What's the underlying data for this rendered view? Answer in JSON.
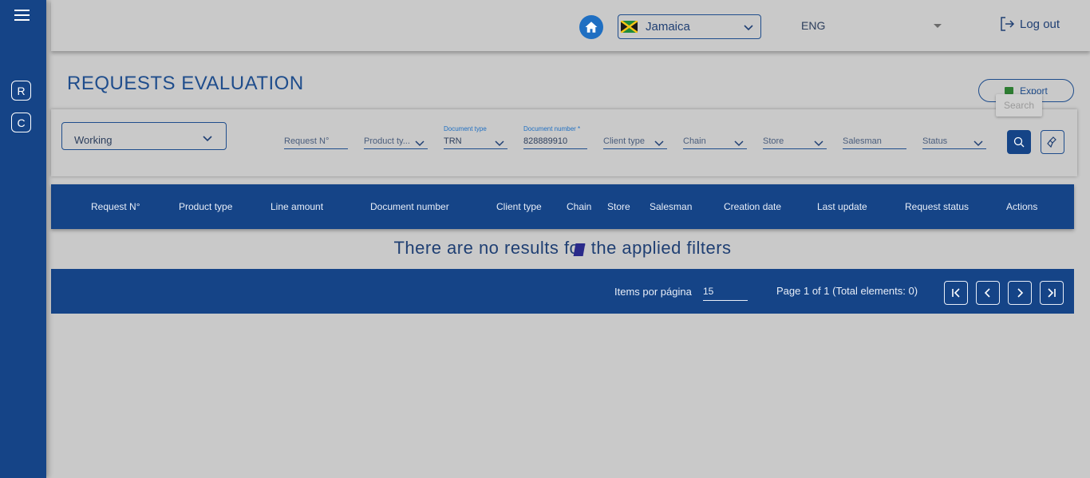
{
  "topbar": {
    "country": "Jamaica",
    "language": "ENG",
    "logout_label": "Log out"
  },
  "page": {
    "title": "REQUESTS EVALUATION",
    "export_label": "Export",
    "search_tooltip": "Search"
  },
  "sidebar": {
    "items": [
      {
        "label": "R"
      },
      {
        "label": "C"
      }
    ]
  },
  "filters": {
    "state_value": "Working",
    "request_no_placeholder": "Request N°",
    "product_type_placeholder": "Product ty...",
    "document_type_label": "Document type",
    "document_type_value": "TRN",
    "document_number_label": "Document number *",
    "document_number_value": "828889910",
    "client_type_placeholder": "Client type",
    "chain_placeholder": "Chain",
    "store_placeholder": "Store",
    "salesman_placeholder": "Salesman",
    "status_placeholder": "Status"
  },
  "table": {
    "columns": [
      "Request N°",
      "Product type",
      "Line amount",
      "Document number",
      "Client type",
      "Chain",
      "Store",
      "Salesman",
      "Creation date",
      "Last update",
      "Request status",
      "Actions"
    ],
    "empty_message": "There are no results for the applied filters"
  },
  "pagination": {
    "items_per_page_label": "Items por página",
    "items_per_page_value": "15",
    "page_info": "Page 1 of 1 (Total elements: 0)"
  },
  "colors": {
    "primary": "#154487",
    "background": "#c9c9c9",
    "home_button": "#1f6fc2"
  }
}
